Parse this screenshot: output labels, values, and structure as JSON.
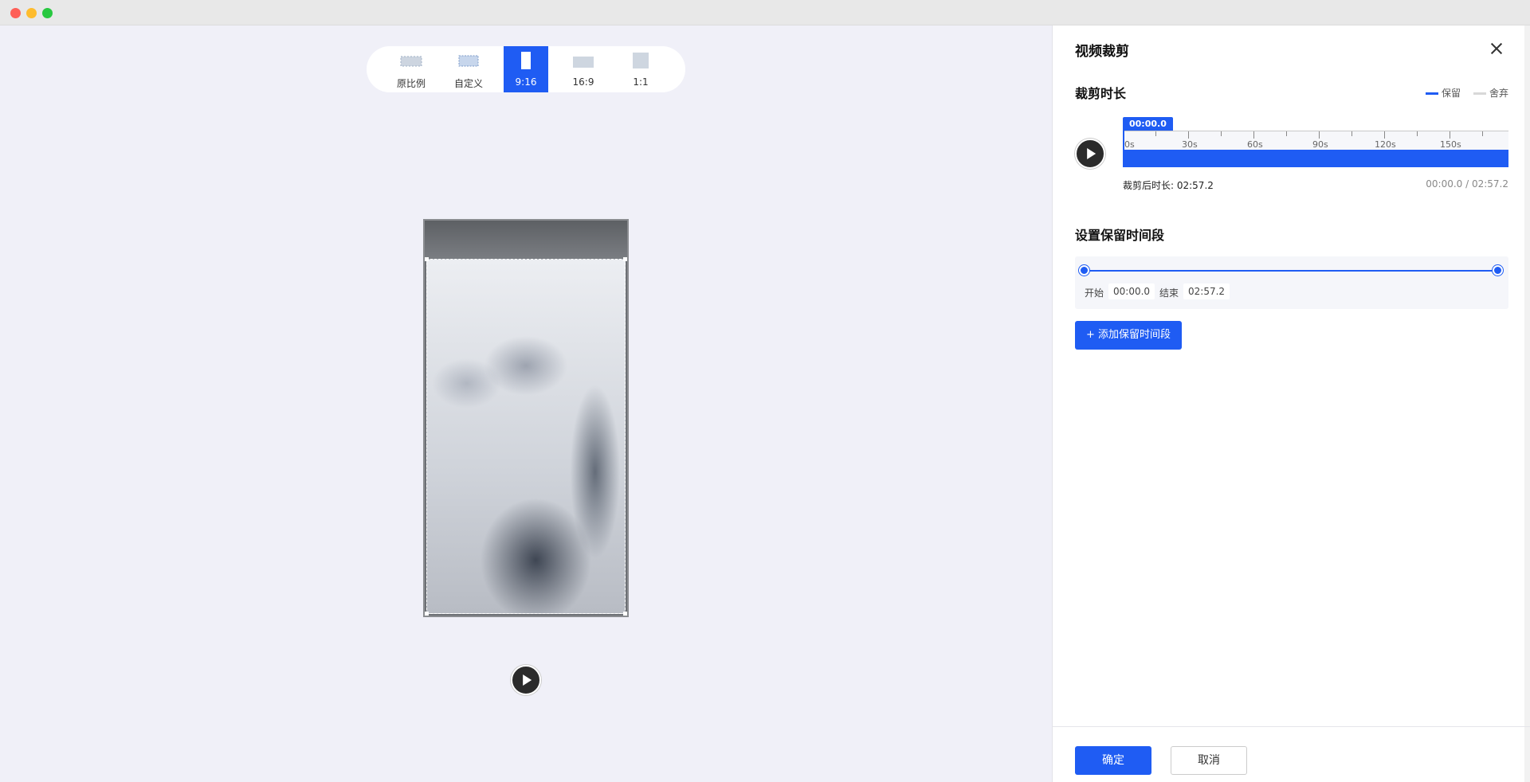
{
  "ratio_options": [
    {
      "label": "原比例",
      "active": false
    },
    {
      "label": "自定义",
      "active": false
    },
    {
      "label": "9:16",
      "active": true
    },
    {
      "label": "16:9",
      "active": false
    },
    {
      "label": "1:1",
      "active": false
    }
  ],
  "panel": {
    "title": "视频裁剪",
    "duration_section": "裁剪时长",
    "legend_keep": "保留",
    "legend_discard": "舍弃",
    "playhead_time": "00:00.0",
    "ruler_labels": [
      "0s",
      "30s",
      "60s",
      "90s",
      "120s",
      "150s"
    ],
    "after_trim_label": "裁剪后时长: 02:57.2",
    "time_readout": "00:00.0 / 02:57.2",
    "segments_section": "设置保留时间段",
    "start_label": "开始",
    "start_value": "00:00.0",
    "end_label": "结束",
    "end_value": "02:57.2",
    "add_segment": "+ 添加保留时间段",
    "confirm": "确定",
    "cancel": "取消"
  },
  "colors": {
    "accent": "#1f5cf3",
    "discard": "#d8d8d8"
  }
}
